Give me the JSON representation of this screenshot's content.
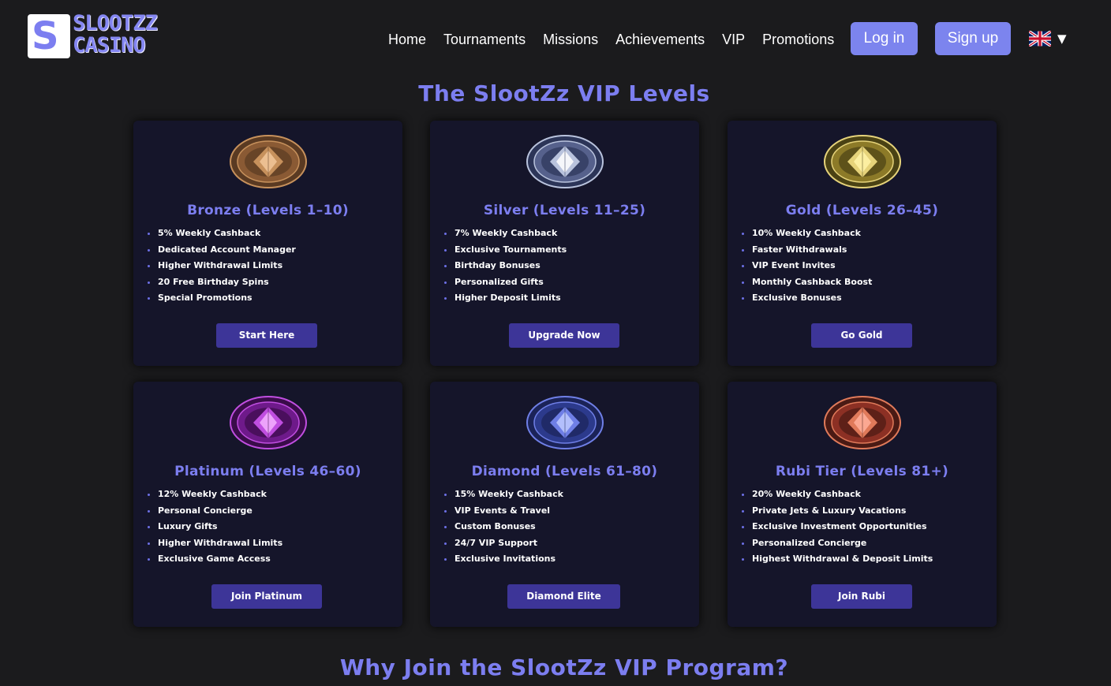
{
  "logo": {
    "badge_letter": "S",
    "line1": "SLOOTZZ",
    "line2": "CASINO"
  },
  "nav": [
    "Home",
    "Tournaments",
    "Missions",
    "Achievements",
    "VIP",
    "Promotions"
  ],
  "auth": {
    "login": "Log in",
    "signup": "Sign up"
  },
  "language": {
    "flag": "uk-flag-icon",
    "caret": "▼"
  },
  "vip_title": "The SlootZz VIP Levels",
  "why_title": "Why Join the SlootZz VIP Program?",
  "colors": {
    "accent": "#7c7ef0",
    "button": "#3d3598",
    "card": "#15152a",
    "background": "#1b1b1d",
    "top_button": "#7c84ee"
  },
  "tiers": [
    {
      "title": "Bronze (Levels 1–10)",
      "icon": "bronze-medal-icon",
      "perks": [
        "5% Weekly Cashback",
        "Dedicated Account Manager",
        "Higher Withdrawal Limits",
        "20 Free Birthday Spins",
        "Special Promotions"
      ],
      "button": "Start Here"
    },
    {
      "title": "Silver (Levels 11–25)",
      "icon": "silver-medal-icon",
      "perks": [
        "7% Weekly Cashback",
        "Exclusive Tournaments",
        "Birthday Bonuses",
        "Personalized Gifts",
        "Higher Deposit Limits"
      ],
      "button": "Upgrade Now"
    },
    {
      "title": "Gold (Levels 26–45)",
      "icon": "gold-medal-icon",
      "perks": [
        "10% Weekly Cashback",
        "Faster Withdrawals",
        "VIP Event Invites",
        "Monthly Cashback Boost",
        "Exclusive Bonuses"
      ],
      "button": "Go Gold"
    },
    {
      "title": "Platinum (Levels 46–60)",
      "icon": "platinum-medal-icon",
      "perks": [
        "12% Weekly Cashback",
        "Personal Concierge",
        "Luxury Gifts",
        "Higher Withdrawal Limits",
        "Exclusive Game Access"
      ],
      "button": "Join Platinum"
    },
    {
      "title": "Diamond (Levels 61–80)",
      "icon": "diamond-medal-icon",
      "perks": [
        "15% Weekly Cashback",
        "VIP Events & Travel",
        "Custom Bonuses",
        "24/7 VIP Support",
        "Exclusive Invitations"
      ],
      "button": "Diamond Elite"
    },
    {
      "title": "Rubi Tier (Levels 81+)",
      "icon": "ruby-medal-icon",
      "perks": [
        "20% Weekly Cashback",
        "Private Jets & Luxury Vacations",
        "Exclusive Investment Opportunities",
        "Personalized Concierge",
        "Highest Withdrawal & Deposit Limits"
      ],
      "button": "Join Rubi"
    }
  ]
}
